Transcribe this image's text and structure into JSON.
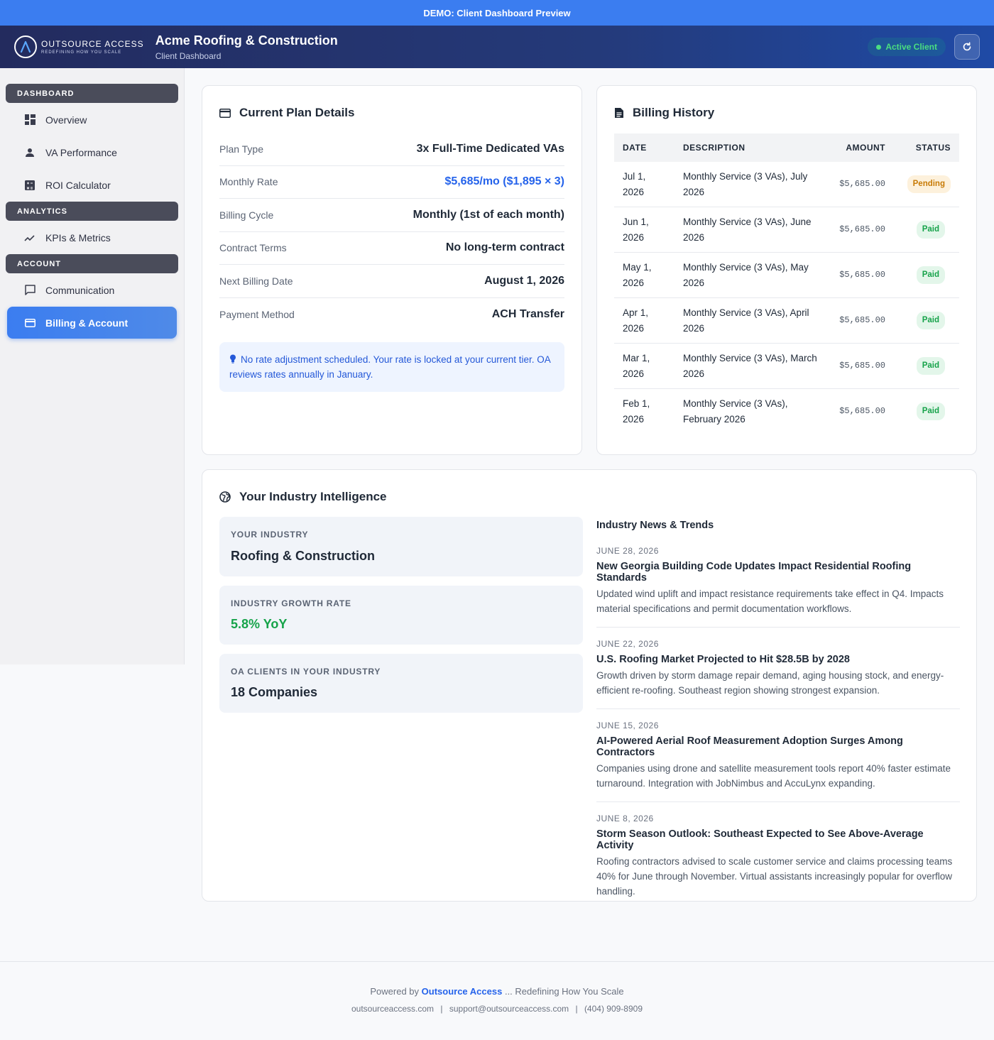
{
  "demo_bar": "DEMO: Client Dashboard Preview",
  "header": {
    "logo_main": "OUTSOURCE ACCESS",
    "logo_tagline": "REDEFINING HOW YOU SCALE",
    "client_name": "Acme Roofing & Construction",
    "subtitle": "Client Dashboard",
    "status_badge": "Active Client"
  },
  "sidebar": {
    "sections": [
      "DASHBOARD",
      "ANALYTICS",
      "ACCOUNT"
    ],
    "items": [
      {
        "label": "Overview",
        "icon": "grid-icon"
      },
      {
        "label": "VA Performance",
        "icon": "person-icon"
      },
      {
        "label": "ROI Calculator",
        "icon": "calculator-icon"
      },
      {
        "label": "KPIs & Metrics",
        "icon": "trend-icon"
      },
      {
        "label": "Communication",
        "icon": "chat-icon"
      },
      {
        "label": "Billing & Account",
        "icon": "credit-card-icon",
        "active": true
      }
    ]
  },
  "plan": {
    "title": "Current Plan Details",
    "rows": [
      {
        "label": "Plan Type",
        "value": "3x Full-Time Dedicated VAs"
      },
      {
        "label": "Monthly Rate",
        "value": "$5,685/mo ($1,895 × 3)"
      },
      {
        "label": "Billing Cycle",
        "value": "Monthly (1st of each month)"
      },
      {
        "label": "Contract Terms",
        "value": "No long-term contract"
      },
      {
        "label": "Next Billing Date",
        "value": "August 1, 2026"
      },
      {
        "label": "Payment Method",
        "value": "ACH Transfer"
      }
    ],
    "note": "No rate adjustment scheduled. Your rate is locked at your current tier. OA reviews rates annually in January."
  },
  "billing": {
    "title": "Billing History",
    "columns": [
      "DATE",
      "DESCRIPTION",
      "AMOUNT",
      "STATUS"
    ],
    "rows": [
      {
        "date": "Jul 1, 2026",
        "desc": "Monthly Service (3 VAs), July 2026",
        "amount": "$5,685.00",
        "status": "Pending"
      },
      {
        "date": "Jun 1, 2026",
        "desc": "Monthly Service (3 VAs), June 2026",
        "amount": "$5,685.00",
        "status": "Paid"
      },
      {
        "date": "May 1, 2026",
        "desc": "Monthly Service (3 VAs), May 2026",
        "amount": "$5,685.00",
        "status": "Paid"
      },
      {
        "date": "Apr 1, 2026",
        "desc": "Monthly Service (3 VAs), April 2026",
        "amount": "$5,685.00",
        "status": "Paid"
      },
      {
        "date": "Mar 1, 2026",
        "desc": "Monthly Service (3 VAs), March 2026",
        "amount": "$5,685.00",
        "status": "Paid"
      },
      {
        "date": "Feb 1, 2026",
        "desc": "Monthly Service (3 VAs), February 2026",
        "amount": "$5,685.00",
        "status": "Paid"
      }
    ]
  },
  "industry": {
    "title": "Your Industry Intelligence",
    "boxes": [
      {
        "label": "YOUR INDUSTRY",
        "value": "Roofing & Construction"
      },
      {
        "label": "INDUSTRY GROWTH RATE",
        "value": "5.8% YoY"
      },
      {
        "label": "OA CLIENTS IN YOUR INDUSTRY",
        "value": "18 Companies"
      }
    ],
    "news_heading": "Industry News & Trends",
    "news": [
      {
        "date": "JUNE 28, 2026",
        "title": "New Georgia Building Code Updates Impact Residential Roofing Standards",
        "desc": "Updated wind uplift and impact resistance requirements take effect in Q4. Impacts material specifications and permit documentation workflows."
      },
      {
        "date": "JUNE 22, 2026",
        "title": "U.S. Roofing Market Projected to Hit $28.5B by 2028",
        "desc": "Growth driven by storm damage repair demand, aging housing stock, and energy-efficient re-roofing. Southeast region showing strongest expansion."
      },
      {
        "date": "JUNE 15, 2026",
        "title": "AI-Powered Aerial Roof Measurement Adoption Surges Among Contractors",
        "desc": "Companies using drone and satellite measurement tools report 40% faster estimate turnaround. Integration with JobNimbus and AccuLynx expanding."
      },
      {
        "date": "JUNE 8, 2026",
        "title": "Storm Season Outlook: Southeast Expected to See Above-Average Activity",
        "desc": "Roofing contractors advised to scale customer service and claims processing teams 40% for June through November. Virtual assistants increasingly popular for overflow handling."
      }
    ]
  },
  "footer": {
    "powered_prefix": "Powered by",
    "brand": "Outsource Access",
    "powered_suffix": "... Redefining How You Scale",
    "website": "outsourceaccess.com",
    "email": "support@outsourceaccess.com",
    "phone": "(404) 909-8909"
  },
  "colors": {
    "accent": "#3b7df0",
    "header_dark": "#232b5e",
    "paid": "#16a34a",
    "pending": "#c87b06"
  }
}
